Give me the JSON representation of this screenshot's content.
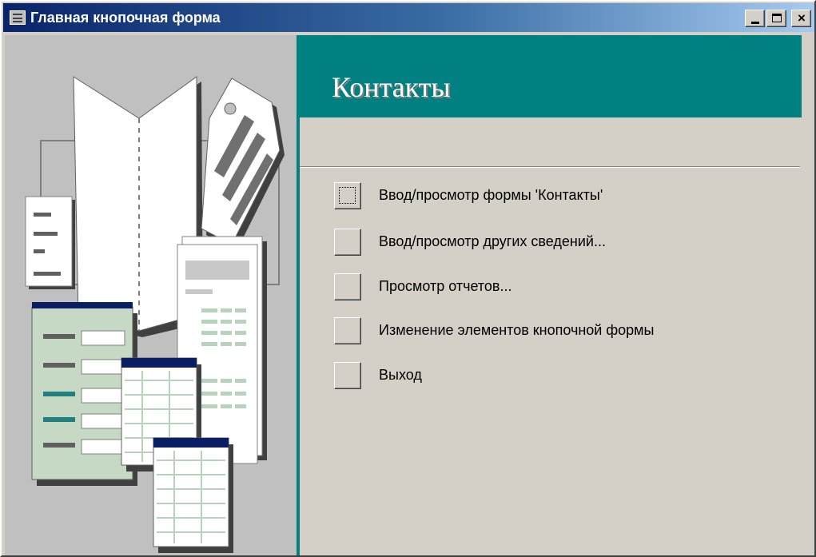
{
  "window": {
    "title": "Главная кнопочная форма",
    "minimize_label": "_",
    "maximize_label": "□",
    "close_label": "×"
  },
  "header": {
    "title": "Контакты"
  },
  "menu": {
    "items": [
      {
        "label": "Ввод/просмотр формы 'Контакты'",
        "focused": true
      },
      {
        "label": "Ввод/просмотр других сведений...",
        "focused": false
      },
      {
        "label": "Просмотр отчетов...",
        "focused": false
      },
      {
        "label": "Изменение элементов кнопочной формы",
        "focused": false
      },
      {
        "label": "Выход",
        "focused": false
      }
    ]
  },
  "colors": {
    "accent": "#008080",
    "titlebar_start": "#0a246a",
    "titlebar_end": "#a6caf0",
    "face": "#d4d0c8"
  },
  "icons": [
    "form-icon",
    "minimize-icon",
    "maximize-icon",
    "close-icon",
    "switchboard-illustration"
  ]
}
